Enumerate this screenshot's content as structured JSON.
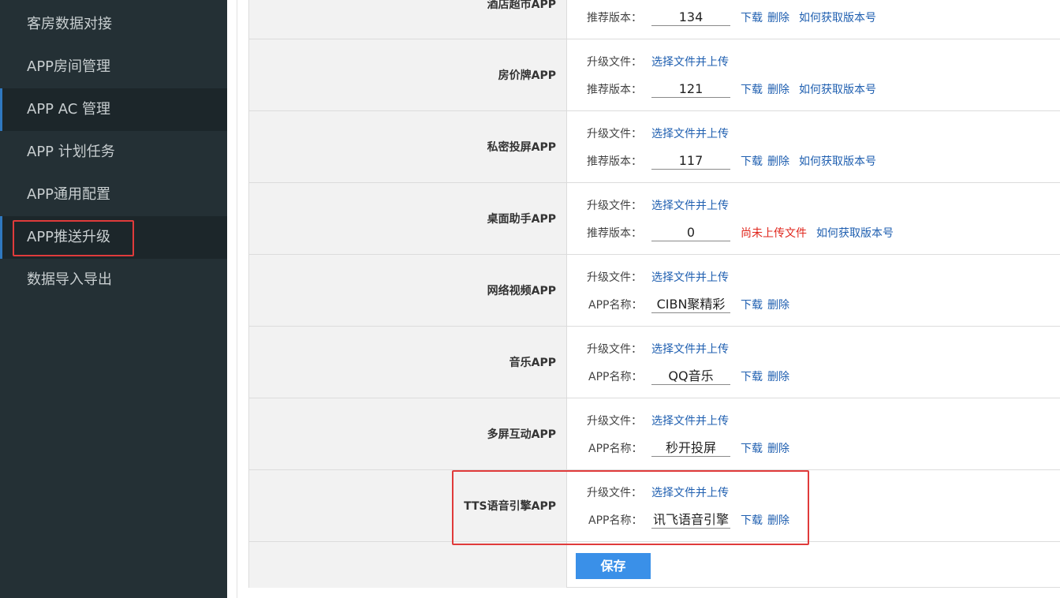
{
  "sidebar": {
    "items": [
      {
        "label": "客房数据对接"
      },
      {
        "label": "APP房间管理"
      },
      {
        "label": "APP AC 管理"
      },
      {
        "label": "APP 计划任务"
      },
      {
        "label": "APP通用配置"
      },
      {
        "label": "APP推送升级"
      },
      {
        "label": "数据导入导出"
      }
    ]
  },
  "rows": [
    {
      "name": "酒店超市APP",
      "line2_label": "推荐版本：",
      "line2_value": "134",
      "download": "下载",
      "delete": "删除",
      "howto": "如何获取版本号"
    },
    {
      "name": "房价牌APP",
      "line1_label": "升级文件：",
      "upload": "选择文件并上传",
      "line2_label": "推荐版本：",
      "line2_value": "121",
      "download": "下载",
      "delete": "删除",
      "howto": "如何获取版本号"
    },
    {
      "name": "私密投屏APP",
      "line1_label": "升级文件：",
      "upload": "选择文件并上传",
      "line2_label": "推荐版本：",
      "line2_value": "117",
      "download": "下载",
      "delete": "删除",
      "howto": "如何获取版本号"
    },
    {
      "name": "桌面助手APP",
      "line1_label": "升级文件：",
      "upload": "选择文件并上传",
      "line2_label": "推荐版本：",
      "line2_value": "0",
      "not_uploaded": "尚未上传文件",
      "howto": "如何获取版本号"
    },
    {
      "name": "网络视频APP",
      "line1_label": "升级文件：",
      "upload": "选择文件并上传",
      "line2_label": "APP名称：",
      "line2_value": "CIBN聚精彩",
      "download": "下载",
      "delete": "删除"
    },
    {
      "name": "音乐APP",
      "line1_label": "升级文件：",
      "upload": "选择文件并上传",
      "line2_label": "APP名称：",
      "line2_value": "QQ音乐",
      "download": "下载",
      "delete": "删除"
    },
    {
      "name": "多屏互动APP",
      "line1_label": "升级文件：",
      "upload": "选择文件并上传",
      "line2_label": "APP名称：",
      "line2_value": "秒开投屏",
      "download": "下载",
      "delete": "删除"
    },
    {
      "name": "TTS语音引擎APP",
      "line1_label": "升级文件：",
      "upload": "选择文件并上传",
      "line2_label": "APP名称：",
      "line2_value": "讯飞语音引擎",
      "download": "下载",
      "delete": "删除"
    }
  ],
  "save_label": "保存",
  "colors": {
    "sidebar_bg": "#243035",
    "link": "#1f5fb0",
    "warning": "#e0261c",
    "highlight_box": "#e03b3b",
    "save_button": "#3a90e8"
  }
}
